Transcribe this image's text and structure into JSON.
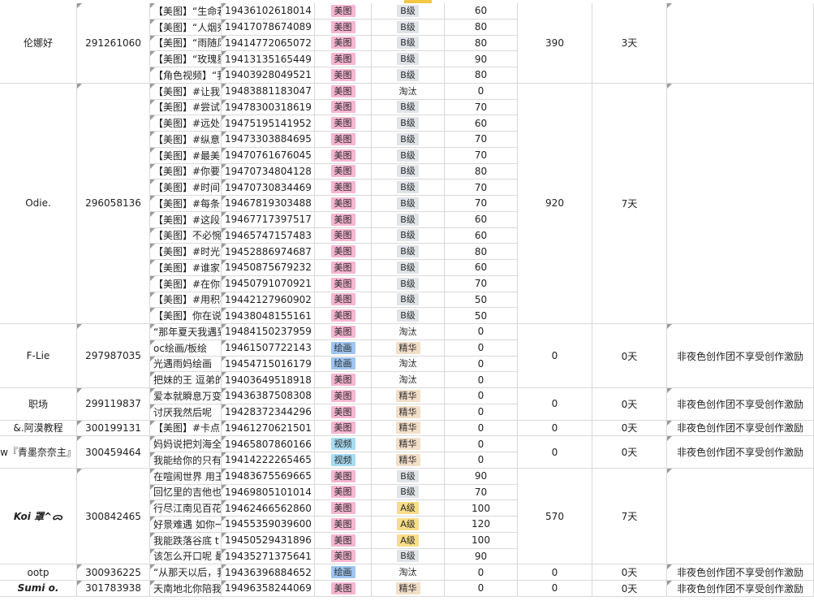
{
  "tag_styles": {
    "美图": {
      "bg": "#f6b6d2",
      "fg": "#2a2a2a"
    },
    "绘画": {
      "bg": "#9ec5f0",
      "fg": "#2a2a2a"
    },
    "视频": {
      "bg": "#a7dcf1",
      "fg": "#2a2a2a"
    },
    "B级": {
      "bg": "#e0e3e8",
      "fg": "#2a2a2a"
    },
    "A级": {
      "bg": "#f8dd88",
      "fg": "#2a2a2a"
    },
    "淘汰": {
      "bg": "transparent",
      "fg": "#2a2a2a"
    },
    "精华": {
      "bg": "#f3dfc8",
      "fg": "#2a2a2a"
    }
  },
  "groups": [
    {
      "name": "伦娜好",
      "id": "291261060",
      "total": "390",
      "days": "3天",
      "note": "",
      "rows": [
        {
          "title": "【美图】“生命若",
          "vid": "19436102618014",
          "cat": "美图",
          "grade": "B级",
          "score": "60"
        },
        {
          "title": "【美图】“人烟秀",
          "vid": "19417078674089",
          "cat": "美图",
          "grade": "B级",
          "score": "80"
        },
        {
          "title": "【美图】“雨随风",
          "vid": "19414772065072",
          "cat": "美图",
          "grade": "B级",
          "score": "80"
        },
        {
          "title": "【美图】“玫瑰星",
          "vid": "19413135165449",
          "cat": "美图",
          "grade": "B级",
          "score": "90"
        },
        {
          "title": "【角色视频】“我",
          "vid": "19403928049521",
          "cat": "美图",
          "grade": "B级",
          "score": "80"
        }
      ]
    },
    {
      "name": "Odie.",
      "id": "296058136",
      "total": "920",
      "days": "7天",
      "note": "",
      "rows": [
        {
          "title": "【美图】#让我能",
          "vid": "19483881183047",
          "cat": "美图",
          "grade": "淘汰",
          "score": "0"
        },
        {
          "title": "【美图】#尝试着",
          "vid": "19478300318619",
          "cat": "美图",
          "grade": "B级",
          "score": "70"
        },
        {
          "title": "【美图】#远处才",
          "vid": "19475195141952",
          "cat": "美图",
          "grade": "B级",
          "score": "60"
        },
        {
          "title": "【美图】#纵意而",
          "vid": "19473303884695",
          "cat": "美图",
          "grade": "B级",
          "score": "70"
        },
        {
          "title": "【美图】#最美的",
          "vid": "19470761676045",
          "cat": "美图",
          "grade": "B级",
          "score": "70"
        },
        {
          "title": "【美图】#你要的",
          "vid": "19470734804128",
          "cat": "美图",
          "grade": "B级",
          "score": "80"
        },
        {
          "title": "【美图】#时间会",
          "vid": "19470730834469",
          "cat": "美图",
          "grade": "B级",
          "score": "70"
        },
        {
          "title": "【美图】#每条力",
          "vid": "19467819303488",
          "cat": "美图",
          "grade": "B级",
          "score": "70"
        },
        {
          "title": "【美图】#这段日",
          "vid": "19467717397517",
          "cat": "美图",
          "grade": "B级",
          "score": "60"
        },
        {
          "title": "【美图】不必惋",
          "vid": "19465747157483",
          "cat": "美图",
          "grade": "B级",
          "score": "60"
        },
        {
          "title": "【美图】#时光浮",
          "vid": "19452886974687",
          "cat": "美图",
          "grade": "B级",
          "score": "80"
        },
        {
          "title": "【美图】#谁家的",
          "vid": "19450875679232",
          "cat": "美图",
          "grade": "B级",
          "score": "60"
        },
        {
          "title": "【美图】#在你眼",
          "vid": "19450791070921",
          "cat": "美图",
          "grade": "B级",
          "score": "70"
        },
        {
          "title": "【美图】#用积极",
          "vid": "19442127960902",
          "cat": "美图",
          "grade": "B级",
          "score": "50"
        },
        {
          "title": "【美图】你在说",
          "vid": "19438048155161",
          "cat": "美图",
          "grade": "B级",
          "score": "50"
        }
      ]
    },
    {
      "name": "F-Lie",
      "id": "297987035",
      "total": "0",
      "days": "0天",
      "note": "非夜色创作团不享受创作激励",
      "rows": [
        {
          "title": "“那年夏天我遇到",
          "vid": "19484150237959",
          "cat": "美图",
          "grade": "淘汰",
          "score": "0"
        },
        {
          "title": "oc绘画/板绘",
          "vid": "19461507722143",
          "cat": "绘画",
          "grade": "精华",
          "score": "0"
        },
        {
          "title": "光遇雨妈绘画",
          "vid": "19454715016179",
          "cat": "绘画",
          "grade": "淘汰",
          "score": "0"
        },
        {
          "title": "把妹的王 逗弟的",
          "vid": "19403649518918",
          "cat": "美图",
          "grade": "淘汰",
          "score": "0"
        }
      ]
    },
    {
      "name": "职场",
      "id": "299119837",
      "total": "0",
      "days": "0天",
      "note": "非夜色创作团不享受创作激励",
      "rows": [
        {
          "title": "爱本就瞬息万变",
          "vid": "19436387508308",
          "cat": "美图",
          "grade": "精华",
          "score": "0"
        },
        {
          "title": "讨厌我然后呢",
          "vid": "19428372344296",
          "cat": "美图",
          "grade": "精华",
          "score": "0"
        }
      ]
    },
    {
      "name": "&.阿漠教程",
      "id": "300199131",
      "total": "0",
      "days": "0天",
      "note": "非夜色创作团不享受创作激励",
      "rows": [
        {
          "title": "【美图】#卡点(",
          "vid": "19461270621501",
          "cat": "美图",
          "grade": "精华",
          "score": "0"
        }
      ]
    },
    {
      "name": "w『青墨奈奈主』",
      "id": "300459464",
      "total": "0",
      "days": "0天",
      "note": "非夜色创作团不享受创作激励",
      "rows": [
        {
          "title": "妈妈说把刘海全",
          "vid": "19465807860166",
          "cat": "视频",
          "grade": "精华",
          "score": "0"
        },
        {
          "title": "我能给你的只有",
          "vid": "19414222265465",
          "cat": "视频",
          "grade": "精华",
          "score": "0"
        }
      ]
    },
    {
      "name": "Koi 罩^ᯅ",
      "id": "300842465",
      "total": "570",
      "days": "7天",
      "note": "",
      "bold": true,
      "rows": [
        {
          "title": "在喧闹世界 用王",
          "vid": "19483675569665",
          "cat": "美图",
          "grade": "B级",
          "score": "90"
        },
        {
          "title": "回忆里的吉他也",
          "vid": "19469805101014",
          "cat": "美图",
          "grade": "B级",
          "score": "70"
        },
        {
          "title": "行尽江南见百花",
          "vid": "19462466562860",
          "cat": "美图",
          "grade": "A级",
          "score": "100"
        },
        {
          "title": "好景难遇 如你一",
          "vid": "19455359039600",
          "cat": "美图",
          "grade": "A级",
          "score": "120"
        },
        {
          "title": "我能跌落谷底 t",
          "vid": "19450529431896",
          "cat": "美图",
          "grade": "A级",
          "score": "100"
        },
        {
          "title": "该怎么开口呢 最",
          "vid": "19435271375641",
          "cat": "美图",
          "grade": "B级",
          "score": "90"
        }
      ]
    },
    {
      "name": "ootp",
      "id": "300936225",
      "total": "0",
      "days": "0天",
      "note": "非夜色创作团不享受创作激励",
      "rows": [
        {
          "title": "“从那天以后，我",
          "vid": "19436396884652",
          "cat": "绘画",
          "grade": "淘汰",
          "score": "0"
        }
      ]
    },
    {
      "name": "Sumi o.",
      "id": "301783938",
      "total": "0",
      "days": "0天",
      "note": "非夜色创作团不享受创作激励",
      "bold": true,
      "rows": [
        {
          "title": "天南地北你陪我",
          "vid": "19496358244069",
          "cat": "美图",
          "grade": "精华",
          "score": "0"
        }
      ]
    }
  ]
}
